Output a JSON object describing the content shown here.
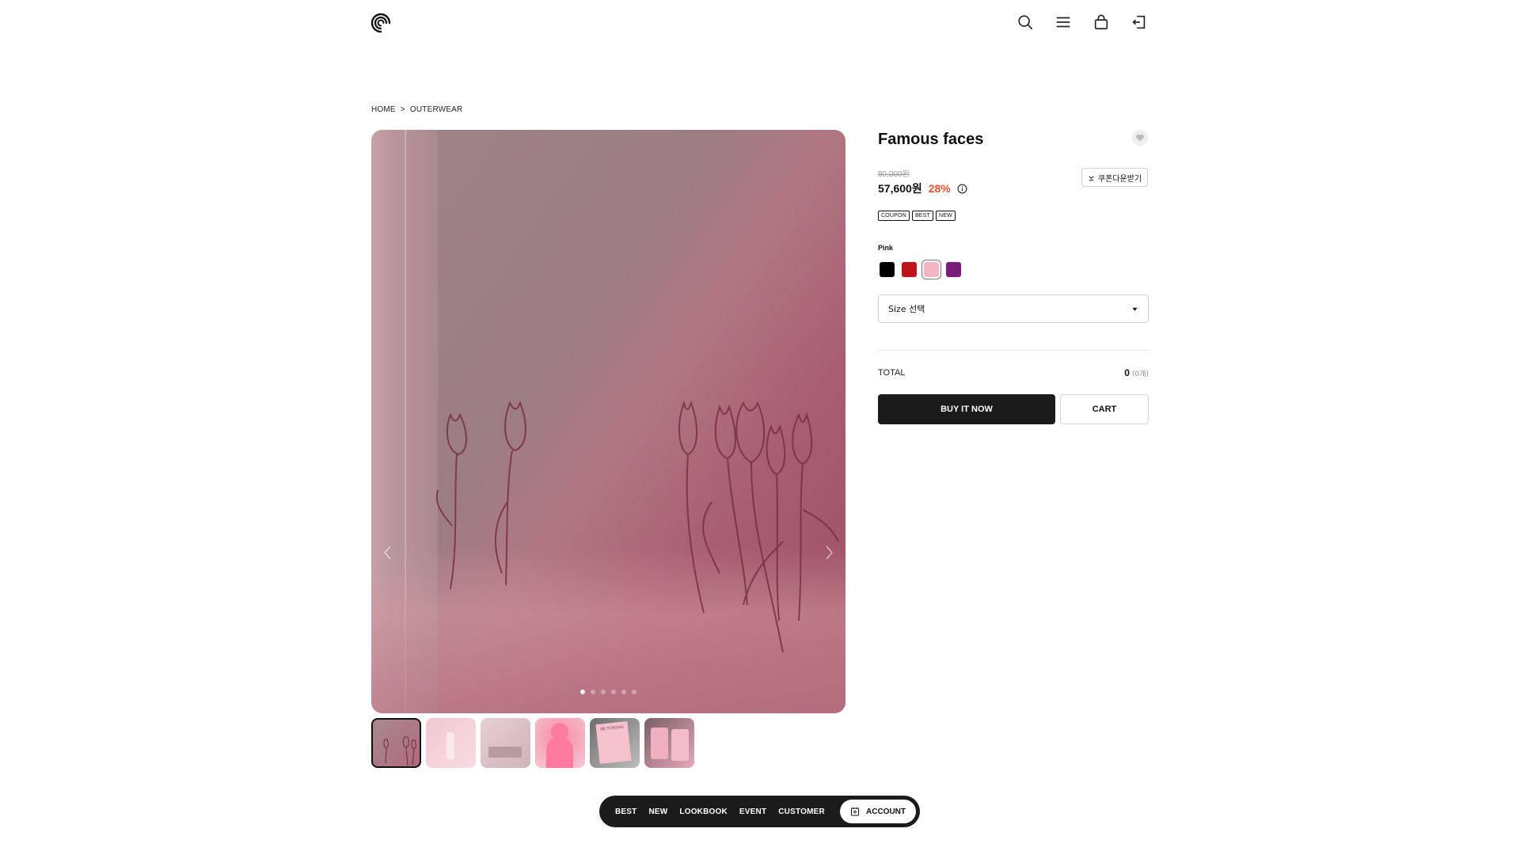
{
  "header": {
    "logo_name": "spiral-logo",
    "icons": [
      "search-icon",
      "menu-icon",
      "bag-icon",
      "login-icon"
    ]
  },
  "breadcrumb": {
    "home": "HOME",
    "sep": ">",
    "current": "OUTERWEAR"
  },
  "product": {
    "title": "Famous faces",
    "original_price": "80,000원",
    "sale_price": "57,600원",
    "discount": "28%",
    "coupon_label": "쿠폰다운받기",
    "badges": [
      "COUPON",
      "BEST",
      "NEW"
    ],
    "selected_color": "Pink",
    "colors": [
      "#000000",
      "#c0141b",
      "#f4b6c2",
      "#7a1c7a"
    ],
    "size_placeholder": "Size 선택",
    "total_label": "TOTAL",
    "total_value": "0",
    "total_count": "(0개)",
    "buy_label": "BUY IT NOW",
    "cart_label": "CART"
  },
  "gallery": {
    "dot_count": 6,
    "active_index": 0,
    "thumbnail_count": 6,
    "thumb5_text": "BE STRONG"
  },
  "bottom_nav": {
    "items": [
      "BEST",
      "NEW",
      "LOOKBOOK",
      "EVENT",
      "CUSTOMER"
    ],
    "account": "ACCOUNT"
  }
}
